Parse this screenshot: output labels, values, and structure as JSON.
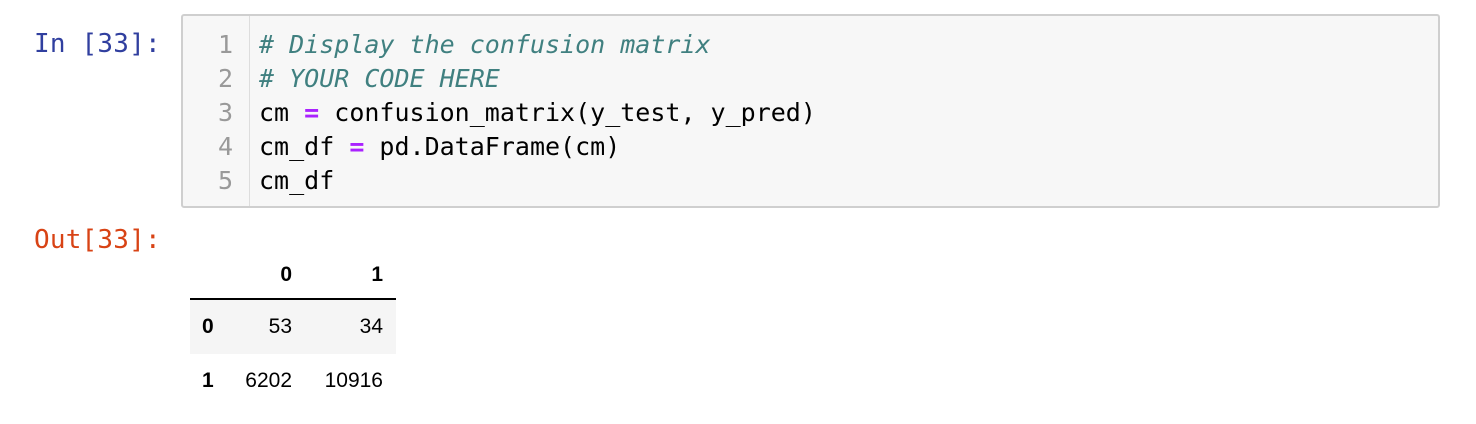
{
  "input_prompt": "In [33]:",
  "output_prompt": "Out[33]:",
  "code": {
    "line_numbers": [
      "1",
      "2",
      "3",
      "4",
      "5"
    ],
    "line1_comment": "# Display the confusion matrix",
    "line2_comment": "# YOUR CODE HERE",
    "line3_var": "cm ",
    "line3_op": "=",
    "line3_rest": " confusion_matrix(y_test, y_pred)",
    "line4_var": "cm_df ",
    "line4_op": "=",
    "line4_rest": " pd.DataFrame(cm)",
    "line5": "cm_df"
  },
  "output_table": {
    "columns": [
      "0",
      "1"
    ],
    "rows": [
      {
        "index": "0",
        "values": [
          "53",
          "34"
        ]
      },
      {
        "index": "1",
        "values": [
          "6202",
          "10916"
        ]
      }
    ]
  },
  "colors": {
    "input_prompt": "#303f9f",
    "output_prompt": "#d84315",
    "comment": "#408080",
    "operator": "#aa22ff",
    "cell_background": "#f7f7f7"
  }
}
